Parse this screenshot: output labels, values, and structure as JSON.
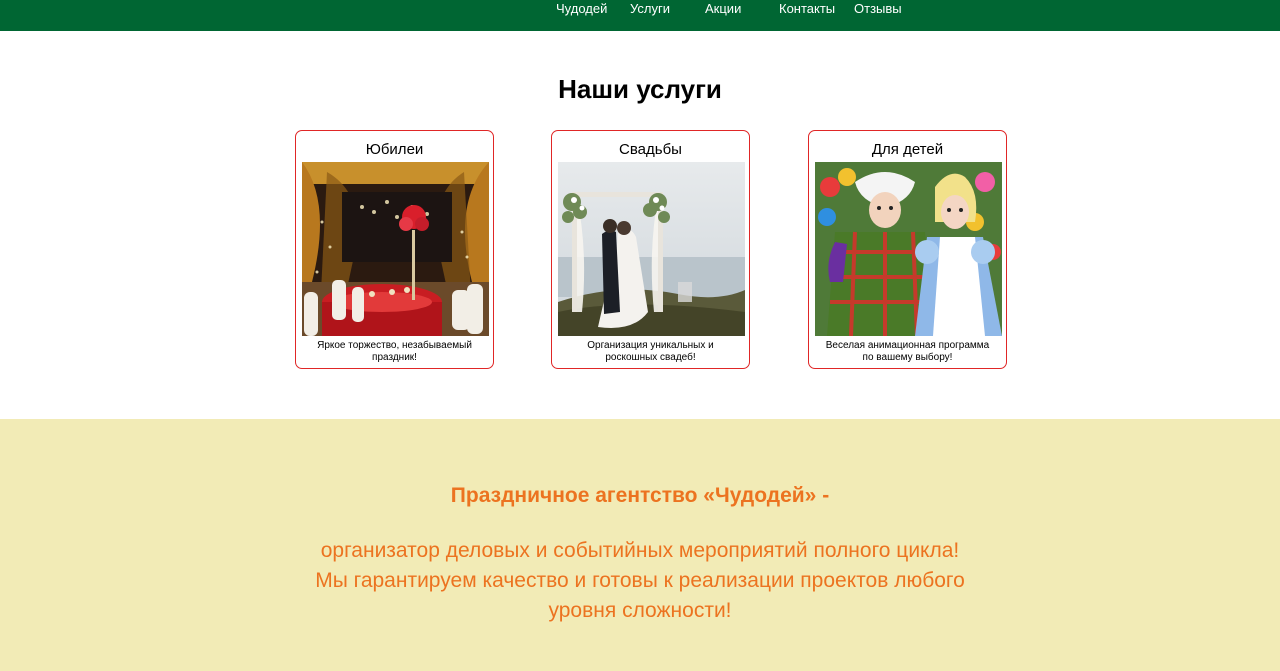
{
  "nav": {
    "items": [
      {
        "label": "Чудодей"
      },
      {
        "label": "Услуги"
      },
      {
        "label": "Акции"
      },
      {
        "label": "Контакты"
      },
      {
        "label": "Отзывы"
      }
    ]
  },
  "services": {
    "title": "Наши услуги",
    "cards": [
      {
        "title": "Юбилеи",
        "text": "Яркое торжество, незабываемый праздник!",
        "photo_icon": "banquet-hall-photo"
      },
      {
        "title": "Свадьбы",
        "text": "Организация уникальных и роскошных свадеб!",
        "photo_icon": "wedding-couple-photo"
      },
      {
        "title": "Для детей",
        "text": "Веселая анимационная программа по вашему выбору!",
        "photo_icon": "kids-animators-photo"
      }
    ]
  },
  "about": {
    "title": "Праздничное агентство «Чудодей» -",
    "lines": [
      "организатор деловых и событийных мероприятий полного цикла!",
      "Мы гарантируем качество и готовы к реализации проектов любого",
      "уровня сложности!"
    ]
  },
  "colors": {
    "topbar": "#006633",
    "card_border": "#e02626",
    "about_bg": "#f2ebb6",
    "about_text": "#ec7320"
  }
}
